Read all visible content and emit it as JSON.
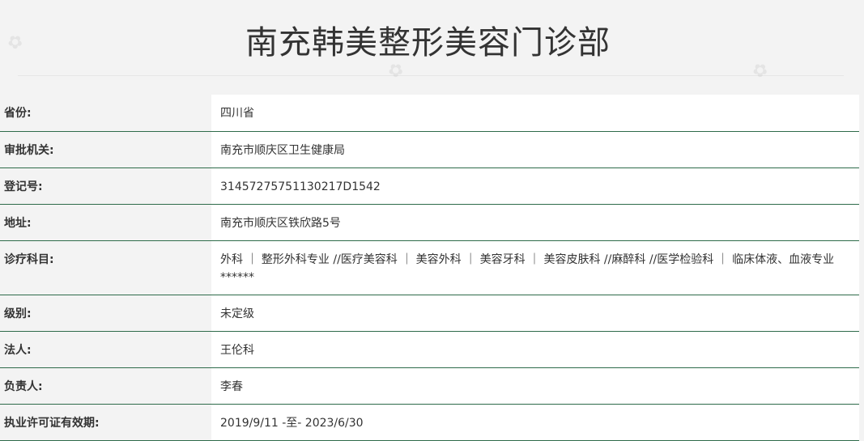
{
  "title": "南充韩美整形美容门诊部",
  "rows": [
    {
      "label": "省份:",
      "value": "四川省"
    },
    {
      "label": "审批机关:",
      "value": "南充市顺庆区卫生健康局"
    },
    {
      "label": "登记号:",
      "value": "31457275751130217D1542"
    },
    {
      "label": "地址:",
      "value": "南充市顺庆区铁欣路5号"
    },
    {
      "label": "诊疗科目:",
      "value": "外科 ｜ 整形外科专业 //医疗美容科 ｜ 美容外科 ｜ 美容牙科 ｜ 美容皮肤科 //麻醉科 //医学检验科 ｜ 临床体液、血液专业******"
    },
    {
      "label": "级别:",
      "value": "未定级"
    },
    {
      "label": "法人:",
      "value": "王伦科"
    },
    {
      "label": "负责人:",
      "value": "李春"
    },
    {
      "label": "执业许可证有效期:",
      "value": "2019/9/11 -至- 2023/6/30"
    }
  ]
}
